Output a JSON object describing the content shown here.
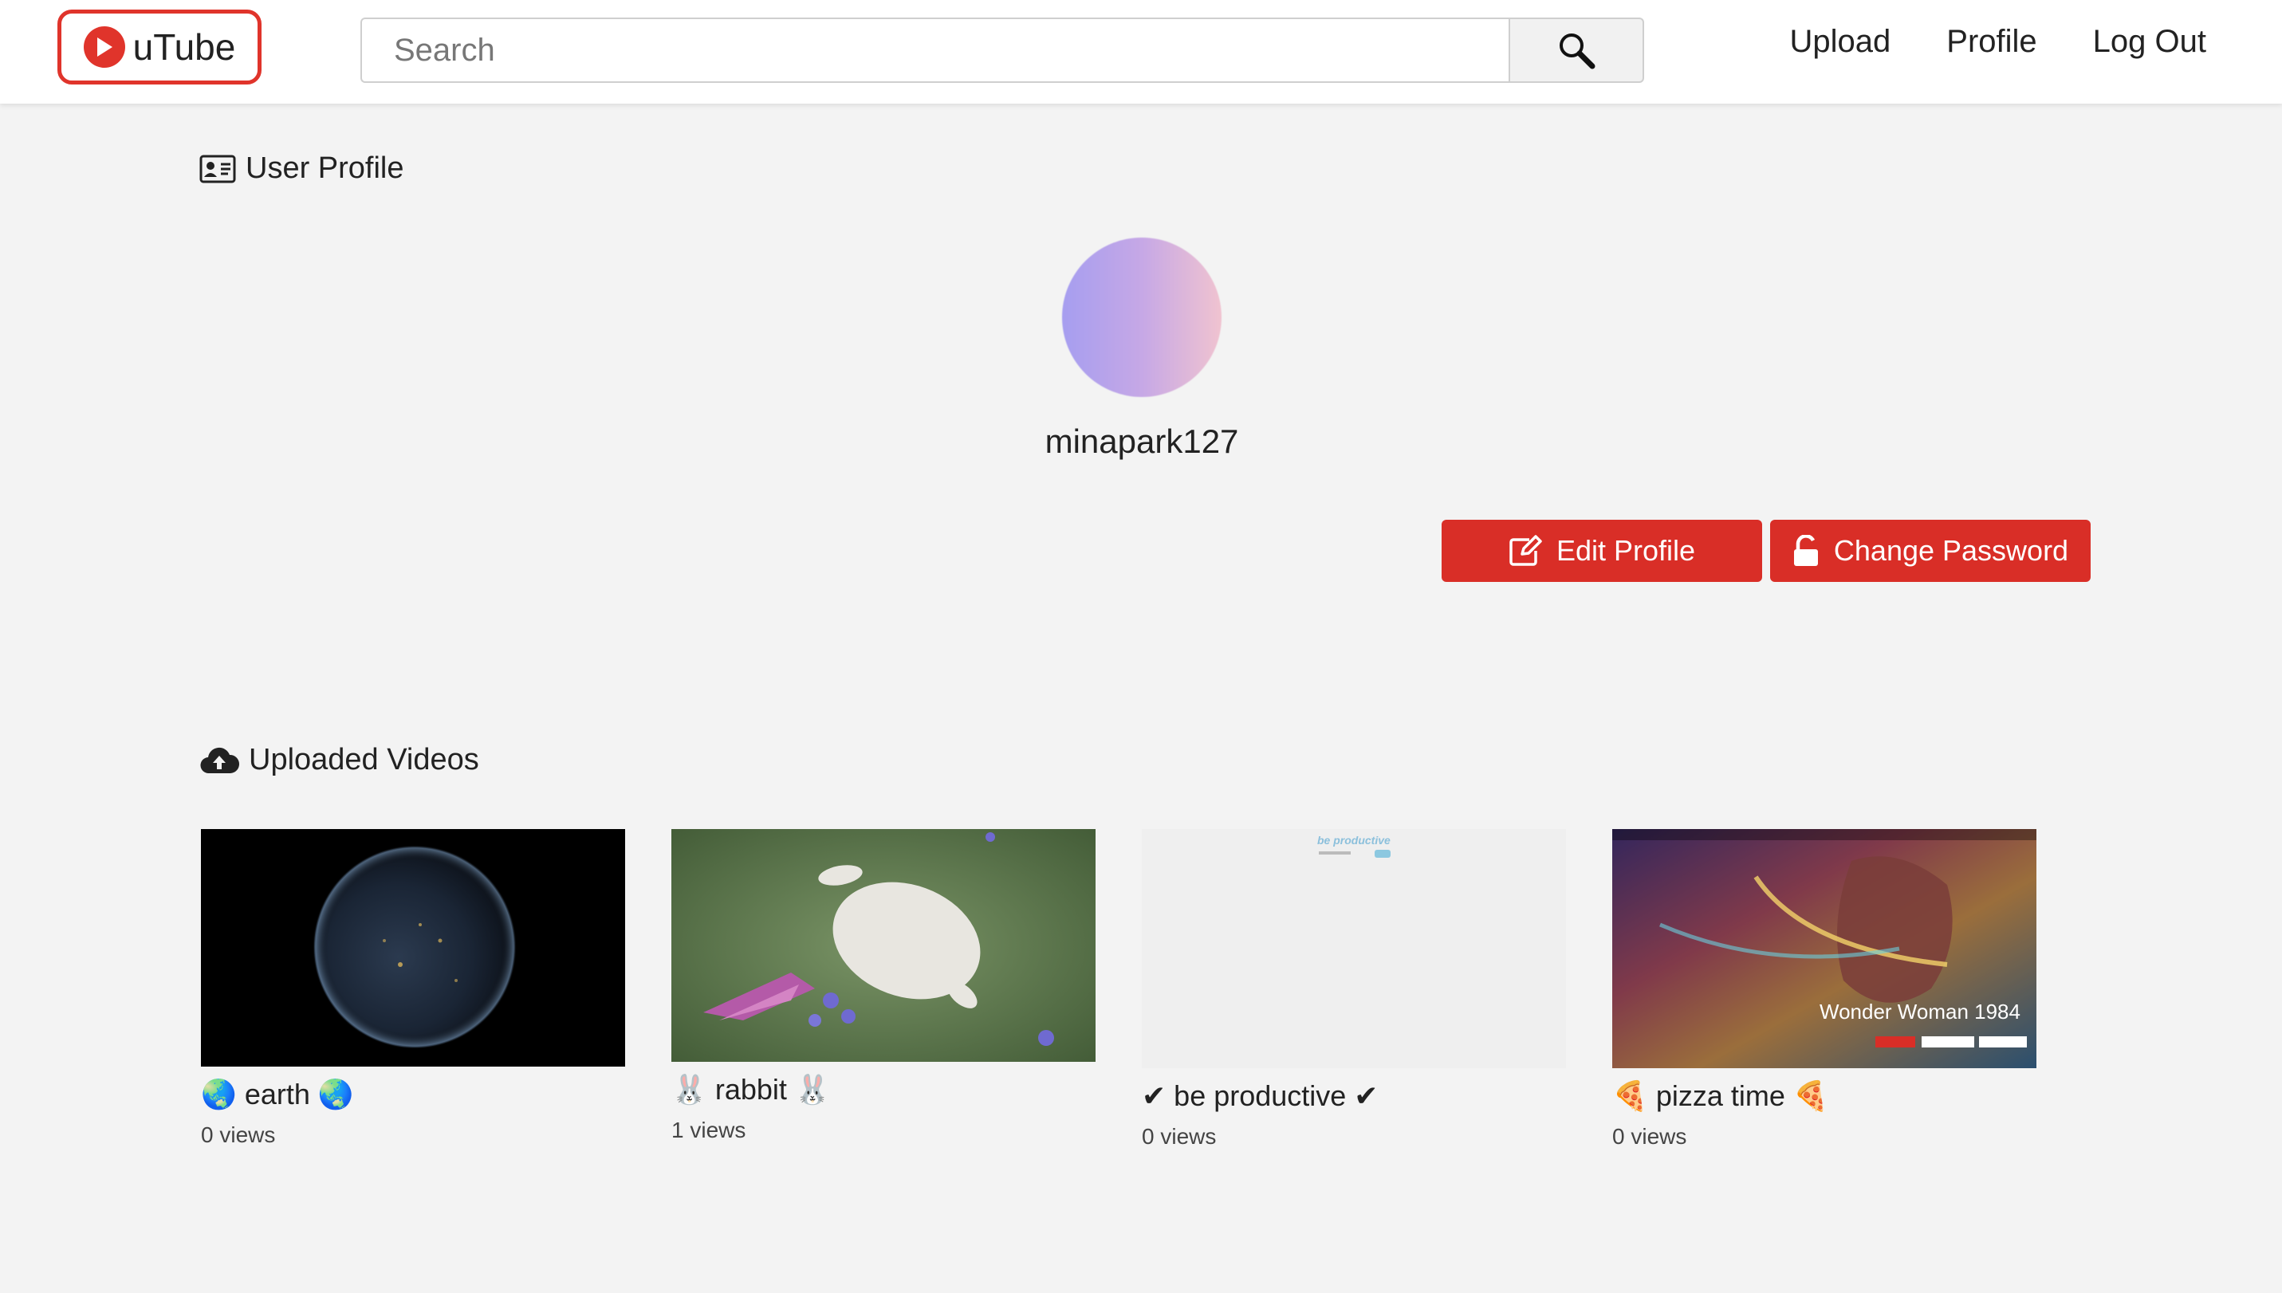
{
  "header": {
    "logo_text": "uTube",
    "search_placeholder": "Search",
    "nav": {
      "upload": "Upload",
      "profile": "Profile",
      "logout": "Log Out"
    }
  },
  "profile": {
    "section_title": "User Profile",
    "username": "minapark127",
    "edit_button": "Edit Profile",
    "change_password_button": "Change Password"
  },
  "videos": {
    "section_title": "Uploaded Videos",
    "items": [
      {
        "title": "🌏 earth 🌏",
        "views": "0 views"
      },
      {
        "title": "🐰 rabbit 🐰",
        "views": "1 views"
      },
      {
        "title": "✔ be productive ✔",
        "views": "0 views",
        "thumb_text": "be productive"
      },
      {
        "title": "🍕 pizza time 🍕",
        "views": "0 views",
        "thumb_text": "Wonder Woman 1984"
      }
    ]
  },
  "colors": {
    "accent": "#d92e27",
    "background": "#f3f3f3",
    "header": "#ffffff"
  }
}
